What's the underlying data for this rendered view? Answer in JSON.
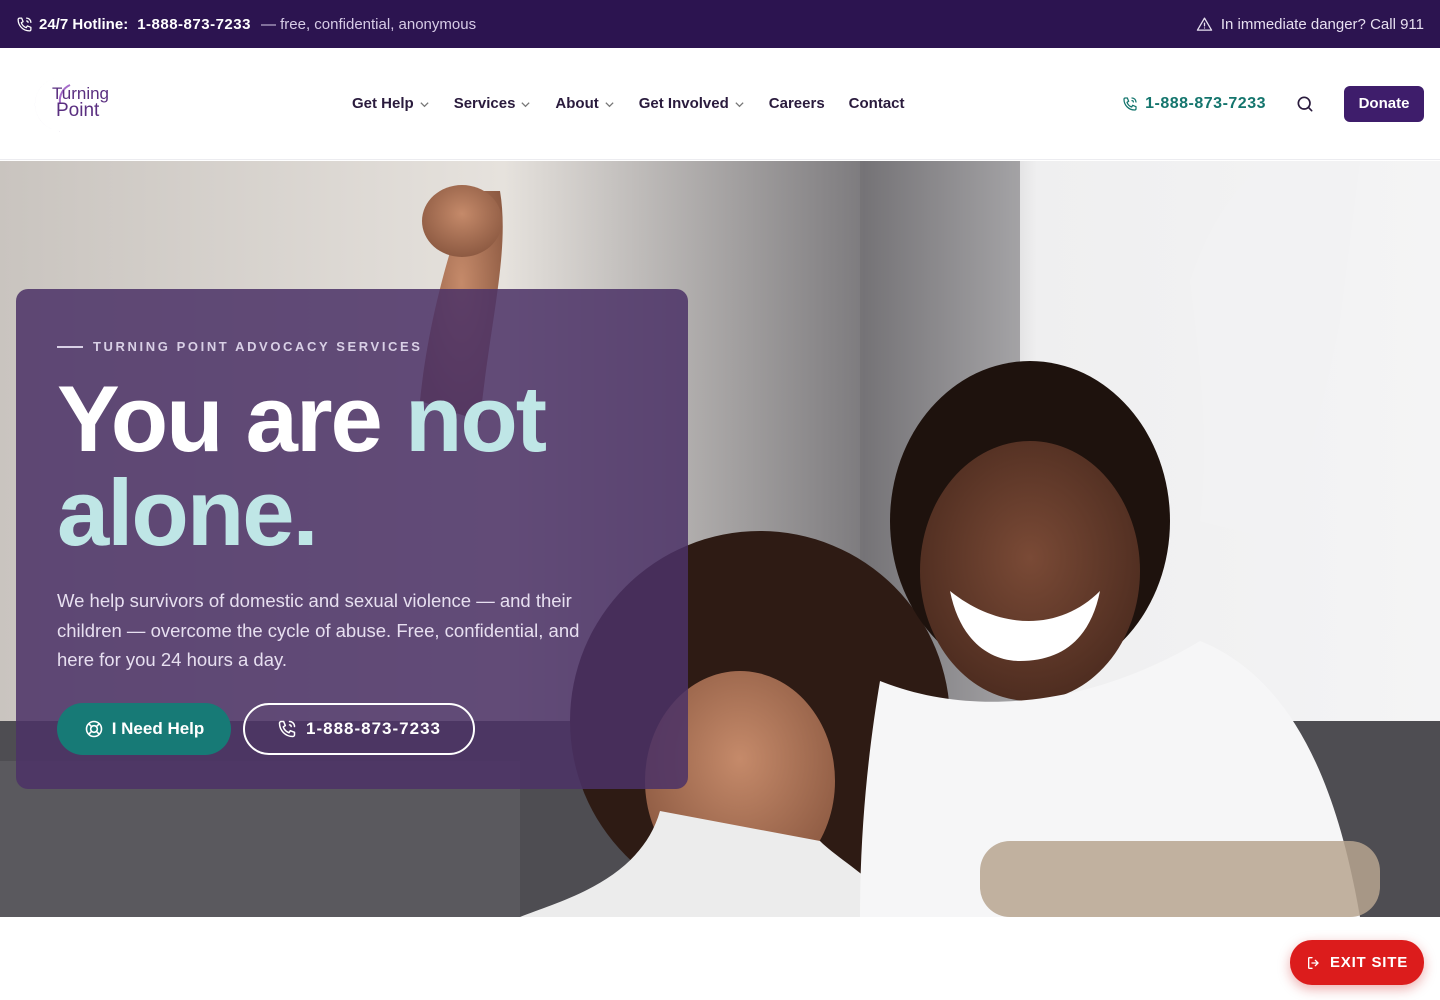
{
  "topbar": {
    "hotline_label": "24/7 Hotline:",
    "hotline_number": "1-888-873-7233",
    "hotline_note": "— free, confidential, anonymous",
    "emergency_text": "In immediate danger? Call 911",
    "icons": [
      "phone-icon",
      "warning-icon"
    ]
  },
  "header": {
    "logo": {
      "line1": "Turning",
      "line2": "Point"
    },
    "nav": [
      {
        "label": "Get Help",
        "has_dropdown": true
      },
      {
        "label": "Services",
        "has_dropdown": true
      },
      {
        "label": "About",
        "has_dropdown": true
      },
      {
        "label": "Get Involved",
        "has_dropdown": true
      },
      {
        "label": "Careers",
        "has_dropdown": false
      },
      {
        "label": "Contact",
        "has_dropdown": false
      }
    ],
    "phone": "1-888-873-7233",
    "donate_label": "Donate"
  },
  "hero": {
    "eyebrow": "TURNING POINT ADVOCACY SERVICES",
    "headline_part1": "You are",
    "headline_accent1": "not",
    "headline_accent2": "alone.",
    "subtext": "We help survivors of domestic and sexual violence — and their children — overcome the cycle of abuse. Free, confidential, and here for you 24 hours a day.",
    "primary_cta": "I Need Help",
    "secondary_cta": "1-888-873-7233"
  },
  "exit_button": {
    "label": "EXIT SITE"
  },
  "colors": {
    "topbar_bg": "#2c1450",
    "brand_purple": "#3e1d6b",
    "card_overlay": "#4c3266",
    "teal": "#177a76",
    "accent_mint": "#bfe6e6",
    "exit_red": "#dc1c1c"
  }
}
